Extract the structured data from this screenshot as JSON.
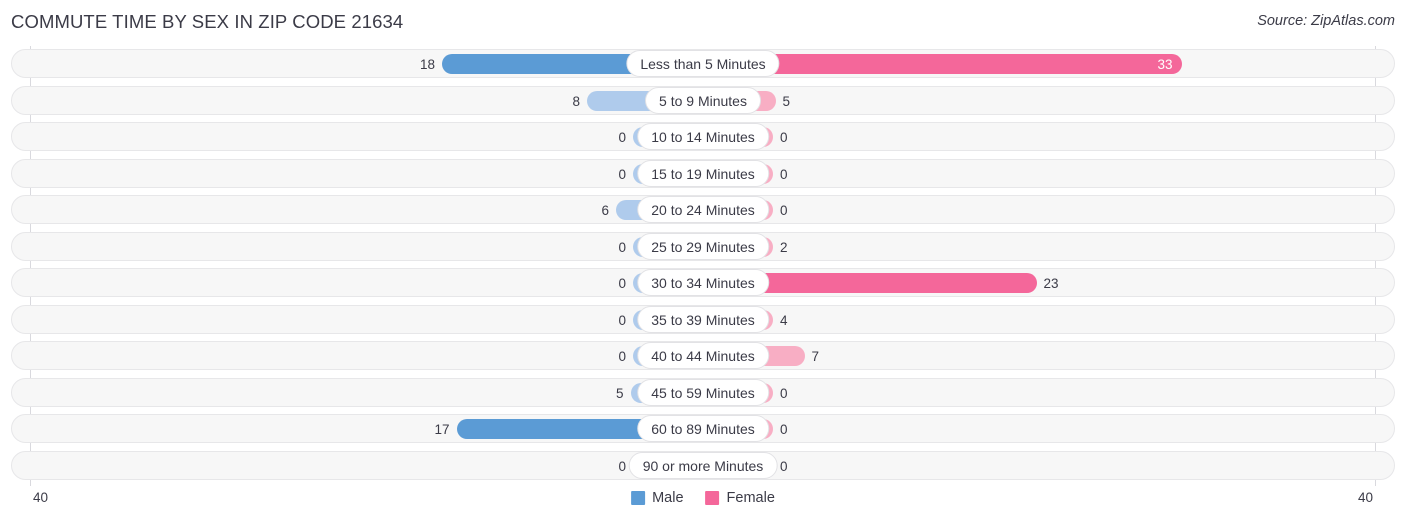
{
  "header": {
    "title": "COMMUTE TIME BY SEX IN ZIP CODE 21634",
    "source": "Source: ZipAtlas.com"
  },
  "legend": {
    "items": [
      {
        "label": "Male",
        "color": "#5B9BD5"
      },
      {
        "label": "Female",
        "color": "#F4679A"
      }
    ]
  },
  "axis": {
    "left_end": "40",
    "right_end": "40"
  },
  "colors": {
    "male_strong": "#5B9BD5",
    "male_light": "#AFCBEC",
    "female_strong": "#F4679A",
    "female_light": "#F8AEC4",
    "track_fill": "#F7F7F7",
    "track_border": "#E7E7E9",
    "gridline": "#D9D9DE",
    "text": "#3B3B47"
  },
  "chart_data": {
    "type": "bar",
    "orientation": "horizontal-diverging",
    "title": "COMMUTE TIME BY SEX IN ZIP CODE 21634",
    "xlabel": "",
    "ylabel": "",
    "xlim": [
      40,
      40
    ],
    "axis_max": 40,
    "grid": true,
    "legend_position": "bottom-center",
    "categories": [
      "Less than 5 Minutes",
      "5 to 9 Minutes",
      "10 to 14 Minutes",
      "15 to 19 Minutes",
      "20 to 24 Minutes",
      "25 to 29 Minutes",
      "30 to 34 Minutes",
      "35 to 39 Minutes",
      "40 to 44 Minutes",
      "45 to 59 Minutes",
      "60 to 89 Minutes",
      "90 or more Minutes"
    ],
    "series": [
      {
        "name": "Male",
        "values": [
          18,
          8,
          0,
          0,
          6,
          0,
          0,
          0,
          0,
          5,
          17,
          0
        ]
      },
      {
        "name": "Female",
        "values": [
          33,
          5,
          0,
          0,
          0,
          2,
          23,
          4,
          7,
          0,
          0,
          0
        ]
      }
    ]
  }
}
